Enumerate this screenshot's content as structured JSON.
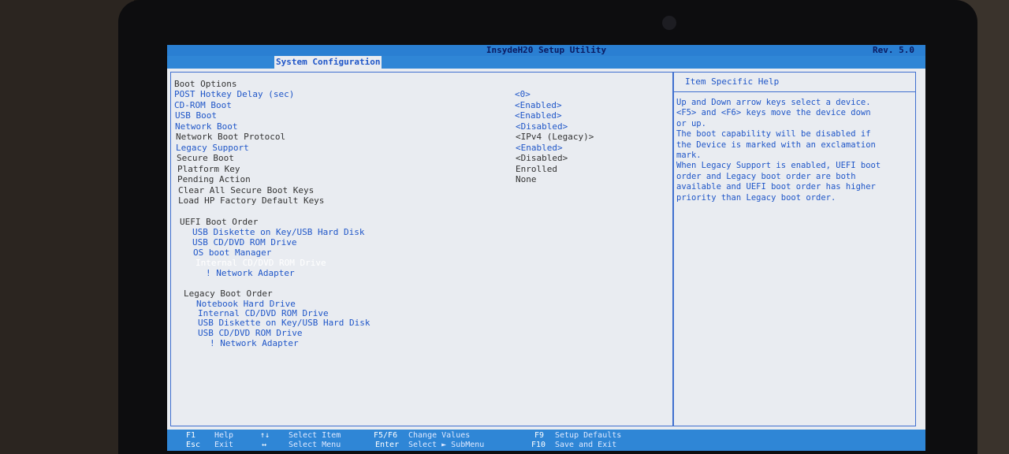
{
  "title": "InsydeH20 Setup Utility",
  "rev": "Rev. 5.0",
  "tab": "System Configuration",
  "settings": [
    {
      "label": "Boot Options",
      "value": "",
      "style": "white"
    },
    {
      "label": "POST Hotkey Delay (sec)",
      "value": "<0>",
      "style": "blue"
    },
    {
      "label": "CD-ROM Boot",
      "value": "<Enabled>",
      "style": "blue"
    },
    {
      "label": "USB Boot",
      "value": "<Enabled>",
      "style": "blue"
    },
    {
      "label": "Network Boot",
      "value": "<Disabled>",
      "style": "blue"
    },
    {
      "label": "Network Boot Protocol",
      "value": "<IPv4 (Legacy)>",
      "style": "white"
    },
    {
      "label": "Legacy Support",
      "value": "<Enabled>",
      "style": "blue"
    },
    {
      "label": "Secure Boot",
      "value": "<Disabled>",
      "style": "white"
    },
    {
      "label": "Platform Key",
      "value": "Enrolled",
      "style": "white"
    },
    {
      "label": "Pending Action",
      "value": "None",
      "style": "white"
    },
    {
      "label": "Clear All Secure Boot Keys",
      "value": "",
      "style": "white"
    },
    {
      "label": "Load HP Factory Default Keys",
      "value": "",
      "style": "white"
    }
  ],
  "uefi": {
    "heading": "UEFI Boot Order",
    "items": [
      "USB Diskette on Key/USB Hard Disk",
      "USB CD/DVD ROM Drive",
      "OS boot Manager",
      "Internal CD/DVD ROM Drive",
      "! Network Adapter"
    ],
    "selected": "Internal CD/DVD ROM Drive"
  },
  "legacy": {
    "heading": "Legacy Boot Order",
    "items": [
      "Notebook Hard Drive",
      "Internal CD/DVD ROM Drive",
      "USB Diskette on Key/USB Hard Disk",
      "USB CD/DVD ROM Drive",
      "! Network Adapter"
    ]
  },
  "help": {
    "title": "Item Specific Help",
    "lines": [
      "Up and Down arrow keys select a device.",
      "<F5> and <F6> keys move the device down",
      "or up.",
      "The boot capability will be disabled if",
      "the Device is marked with an exclamation",
      "mark.",
      "When Legacy Support is enabled, UEFI boot",
      "order and Legacy boot order are both",
      "available and UEFI boot order has higher",
      "priority than Legacy boot order."
    ]
  },
  "keys": {
    "f1": "F1",
    "help": "Help",
    "updown": "↑↓",
    "select_item": "Select Item",
    "f5f6": "F5/F6",
    "change": "Change Values",
    "f9": "F9",
    "defaults": "Setup Defaults",
    "esc": "Esc",
    "exit": "Exit",
    "lr": "↔",
    "select_menu": "Select Menu",
    "enter": "Enter",
    "submenu": "Select ► SubMenu",
    "f10": "F10",
    "save": "Save and Exit"
  },
  "colors": {
    "blue_text": "#1f56c8",
    "bar": "#2f86d6",
    "background": "#e9ecf1"
  }
}
